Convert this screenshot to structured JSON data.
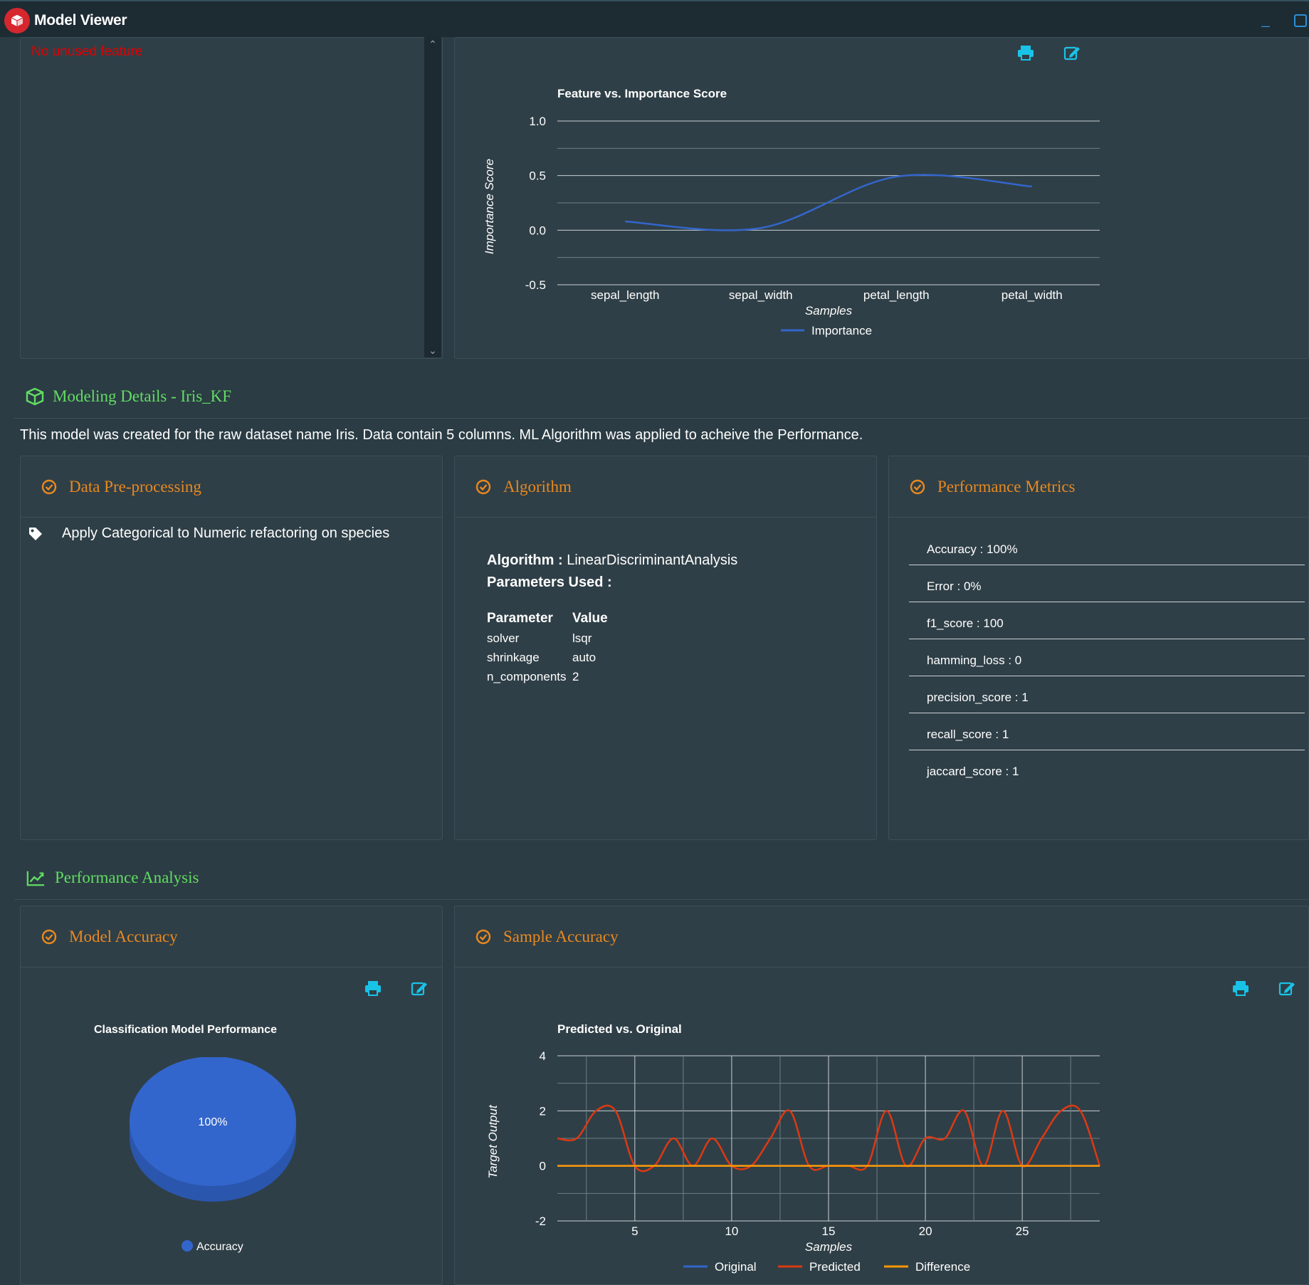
{
  "window": {
    "title": "Model Viewer",
    "minimize": "_"
  },
  "unused": {
    "message": "No unused feature"
  },
  "feature_chart": {
    "chart_data": {
      "type": "line",
      "title": "Feature vs. Importance Score",
      "xlabel": "Samples",
      "ylabel": "Importance Score",
      "categories": [
        "sepal_length",
        "sepal_width",
        "petal_length",
        "petal_width"
      ],
      "series": [
        {
          "name": "Importance",
          "values": [
            0.08,
            0.02,
            0.49,
            0.4
          ]
        }
      ],
      "ylim": [
        -0.5,
        1.0
      ],
      "yticks": [
        "1.0",
        "0.5",
        "0.0",
        "-0.5"
      ],
      "grid": true,
      "legend": "bottom"
    }
  },
  "modeling": {
    "heading": "Modeling Details - Iris_KF",
    "description": "This model was created for the raw dataset name Iris. Data contain 5 columns. ML Algorithm was applied to acheive the Performance."
  },
  "preprocessing": {
    "heading": "Data Pre-processing",
    "items": [
      "Apply Categorical to Numeric refactoring on species"
    ]
  },
  "algorithm": {
    "heading": "Algorithm",
    "algo_label": "Algorithm :",
    "algo_value": "LinearDiscriminantAnalysis",
    "params_label": "Parameters Used :",
    "col_param": "Parameter",
    "col_value": "Value",
    "params": [
      {
        "name": "solver",
        "value": "lsqr"
      },
      {
        "name": "shrinkage",
        "value": "auto"
      },
      {
        "name": "n_components",
        "value": "2"
      }
    ]
  },
  "metrics": {
    "heading": "Performance Metrics",
    "items": [
      "Accuracy : 100%",
      "Error : 0%",
      "f1_score : 100",
      "hamming_loss : 0",
      "precision_score : 1",
      "recall_score : 1",
      "jaccard_score : 1"
    ]
  },
  "performance": {
    "heading": "Performance Analysis"
  },
  "model_accuracy": {
    "heading": "Model Accuracy",
    "chart_data": {
      "type": "pie",
      "title": "Classification Model Performance",
      "slices": [
        {
          "label": "Accuracy",
          "value": 100,
          "display": "100%"
        }
      ],
      "legend": "bottom",
      "colors": [
        "#3366cc"
      ]
    }
  },
  "sample_accuracy": {
    "heading": "Sample Accuracy",
    "chart_data": {
      "type": "line",
      "title": "Predicted vs. Original",
      "xlabel": "Samples",
      "ylabel": "Target Output",
      "ylim": [
        -2,
        4
      ],
      "yticks": [
        "4",
        "2",
        "0",
        "-2"
      ],
      "xticks": [
        "5",
        "10",
        "15",
        "20",
        "25"
      ],
      "x": [
        1,
        2,
        3,
        4,
        5,
        6,
        7,
        8,
        9,
        10,
        11,
        12,
        13,
        14,
        15,
        16,
        17,
        18,
        19,
        20,
        21,
        22,
        23,
        24,
        25,
        26,
        27,
        28,
        29
      ],
      "series": [
        {
          "name": "Original",
          "color": "#3366cc",
          "values": [
            0,
            0,
            0,
            0,
            0,
            0,
            0,
            0,
            0,
            0,
            0,
            0,
            0,
            0,
            0,
            0,
            0,
            0,
            0,
            0,
            0,
            0,
            0,
            0,
            0,
            0,
            0,
            0,
            0
          ]
        },
        {
          "name": "Predicted",
          "color": "#dc3912",
          "values": [
            1,
            1,
            2,
            2,
            0,
            0,
            1,
            0,
            1,
            0,
            0,
            1,
            2,
            0,
            0,
            0,
            0,
            2,
            0,
            1,
            1,
            2,
            0,
            2,
            0,
            1,
            2,
            2,
            0
          ]
        },
        {
          "name": "Difference",
          "color": "#ff9900",
          "values": [
            0,
            0,
            0,
            0,
            0,
            0,
            0,
            0,
            0,
            0,
            0,
            0,
            0,
            0,
            0,
            0,
            0,
            0,
            0,
            0,
            0,
            0,
            0,
            0,
            0,
            0,
            0,
            0,
            0
          ]
        }
      ],
      "grid": true,
      "legend": "bottom"
    }
  }
}
